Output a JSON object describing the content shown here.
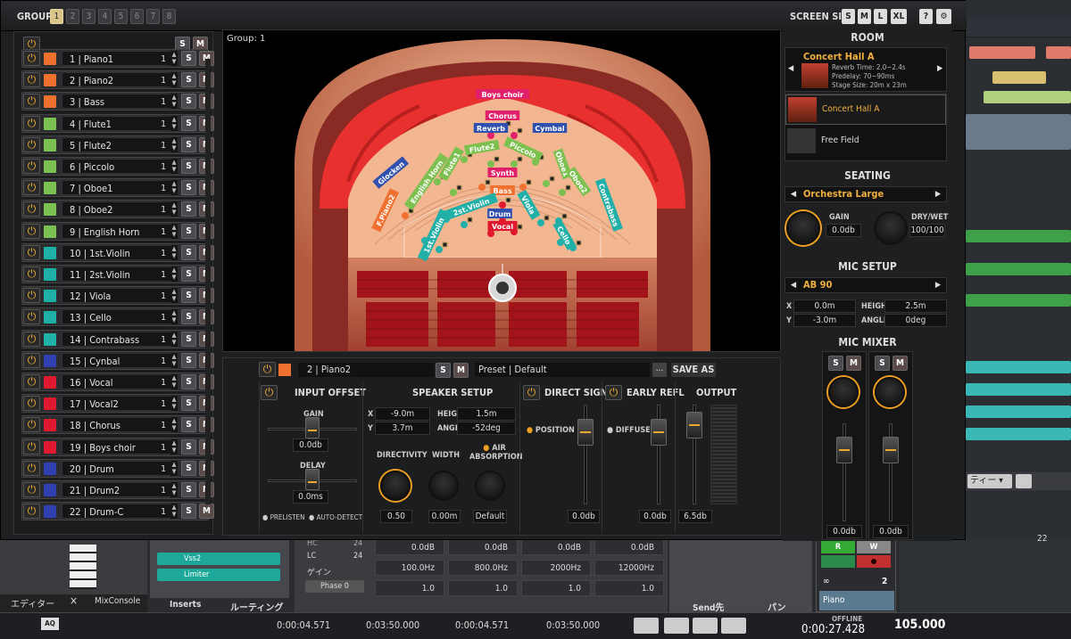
{
  "topbar": {
    "group_label": "GROUP",
    "groups": [
      "1",
      "2",
      "3",
      "4",
      "5",
      "6",
      "7",
      "8"
    ],
    "screen_size_label": "SCREEN SIZE",
    "sizes": [
      "S",
      "M",
      "L",
      "XL"
    ],
    "help": "?"
  },
  "tracklist": {
    "s": "S",
    "m": "M",
    "tracks": [
      {
        "num": "1",
        "name": "Piano1",
        "color": "#f07030"
      },
      {
        "num": "2",
        "name": "Piano2",
        "color": "#f07030"
      },
      {
        "num": "3",
        "name": "Bass",
        "color": "#f07030"
      },
      {
        "num": "4",
        "name": "Flute1",
        "color": "#7cc050"
      },
      {
        "num": "5",
        "name": "Flute2",
        "color": "#7cc050"
      },
      {
        "num": "6",
        "name": "Piccolo",
        "color": "#7cc050"
      },
      {
        "num": "7",
        "name": "Oboe1",
        "color": "#7cc050"
      },
      {
        "num": "8",
        "name": "Oboe2",
        "color": "#7cc050"
      },
      {
        "num": "9",
        "name": "English Horn",
        "color": "#7cc050"
      },
      {
        "num": "10",
        "name": "1st.Violin",
        "color": "#20b0a8"
      },
      {
        "num": "11",
        "name": "2st.Violin",
        "color": "#20b0a8"
      },
      {
        "num": "12",
        "name": "Viola",
        "color": "#20b0a8"
      },
      {
        "num": "13",
        "name": "Cello",
        "color": "#20b0a8"
      },
      {
        "num": "14",
        "name": "Contrabass",
        "color": "#20b0a8"
      },
      {
        "num": "15",
        "name": "Cynbal",
        "color": "#3040b0"
      },
      {
        "num": "16",
        "name": "Vocal",
        "color": "#e01830"
      },
      {
        "num": "17",
        "name": "Vocal2",
        "color": "#e01830"
      },
      {
        "num": "18",
        "name": "Chorus",
        "color": "#e01830"
      },
      {
        "num": "19",
        "name": "Boys choir",
        "color": "#e01830"
      },
      {
        "num": "20",
        "name": "Drum",
        "color": "#3040b0"
      },
      {
        "num": "21",
        "name": "Drum2",
        "color": "#3040b0"
      },
      {
        "num": "22",
        "name": "Drum-C",
        "color": "#3040b0"
      }
    ]
  },
  "stage": {
    "group_label": "Group: 1",
    "labels": [
      {
        "text": "Boys choir",
        "color": "#e0206a"
      },
      {
        "text": "Chorus",
        "color": "#e0206a"
      },
      {
        "text": "Reverb",
        "color": "#3050b0"
      },
      {
        "text": "Cymbal",
        "color": "#3050b0"
      },
      {
        "text": "Cymbal",
        "color": "#3050b0"
      },
      {
        "text": "Flute2",
        "color": "#7cc050"
      },
      {
        "text": "Piccolo",
        "color": "#7cc050"
      },
      {
        "text": "Flute1",
        "color": "#7cc050"
      },
      {
        "text": "Oboe1",
        "color": "#7cc050"
      },
      {
        "text": "Glocken",
        "color": "#3050b0"
      },
      {
        "text": "English Horn",
        "color": "#7cc050"
      },
      {
        "text": "Oboe2",
        "color": "#7cc050"
      },
      {
        "text": "Synth",
        "color": "#e0206a"
      },
      {
        "text": "Bass",
        "color": "#f07030"
      },
      {
        "text": "Contrabass",
        "color": "#20b0a8"
      },
      {
        "text": "2st.Violin",
        "color": "#20b0a8"
      },
      {
        "text": "Viola",
        "color": "#20b0a8"
      },
      {
        "text": "F.Piano2",
        "color": "#f07030"
      },
      {
        "text": "Drum",
        "color": "#3050b0"
      },
      {
        "text": "Vocal",
        "color": "#e01830"
      },
      {
        "text": "1st.Violin",
        "color": "#20b0a8"
      },
      {
        "text": "Cello",
        "color": "#20b0a8"
      }
    ]
  },
  "room": {
    "title": "ROOM",
    "selected": "Concert Hall A",
    "reverb": "Reverb Time: 2.0~2.4s",
    "predelay": "Predelay: 70~90ms",
    "stage_size": "Stage Size: 20m x 23m",
    "list": [
      "Concert Hall A",
      "Free Field"
    ]
  },
  "seating": {
    "title": "SEATING",
    "value": "Orchestra Large",
    "gain_label": "GAIN",
    "gain": "0.0db",
    "drywet_label": "DRY/WET",
    "drywet": "100/100"
  },
  "mic": {
    "title": "MIC SETUP",
    "value": "AB 90",
    "x_label": "X",
    "x": "0.0m",
    "height_label": "HEIGHT",
    "height": "2.5m",
    "y_label": "Y",
    "y": "-3.0m",
    "angle_label": "ANGLE",
    "angle": "0deg"
  },
  "micmixer": {
    "title": "MIC MIXER",
    "val1": "0.0db",
    "val2": "0.0db"
  },
  "editor": {
    "track": "2 | Piano2",
    "preset": "Preset | Default",
    "dots": "...",
    "saveas": "SAVE AS",
    "input_offset": "INPUT OFFSET",
    "gain_label": "GAIN",
    "gain": "0.0db",
    "delay_label": "DELAY",
    "delay": "0.0ms",
    "prelisten": "PRELISTEN",
    "autodetect": "AUTO-DETECT",
    "speaker_setup": "SPEAKER SETUP",
    "x_label": "X",
    "x": "-9.0m",
    "height_label": "HEIGHT",
    "height": "1.5m",
    "y_label": "Y",
    "y": "3.7m",
    "angle_label": "ANGLE",
    "angle": "-52deg",
    "directivity": "DIRECTIVITY",
    "width": "WIDTH",
    "air": "AIR ABSORPTION",
    "dir_val": "0.50",
    "width_val": "0.00m",
    "air_val": "Default",
    "direct_signal": "DIRECT SIGNAL",
    "position": "POSITION",
    "direct_val": "0.0db",
    "early_refl": "EARLY REFL",
    "diffuse": "DIFFUSE",
    "early_val": "0.0db",
    "output": "OUTPUT",
    "output_val": "6.5db"
  },
  "daw": {
    "editor_tab": "エディター",
    "mixconsole_tab": "MixConsole",
    "close": "×",
    "inserts": "Inserts",
    "routing": "ルーティング",
    "send": "Send先",
    "pan": "パン",
    "plugin1": "Vss2",
    "plugin2": "Limiter",
    "hc": "HC",
    "hc_val": "24",
    "lc": "LC",
    "lc_val": "24",
    "gain": "ゲイン",
    "phase": "Phase 0",
    "eq_gain": [
      "0.0dB",
      "0.0dB",
      "0.0dB",
      "0.0dB"
    ],
    "eq_freq": [
      "100.0Hz",
      "800.0Hz",
      "2000Hz",
      "12000Hz"
    ],
    "eq_q": [
      "1.0",
      "1.0",
      "1.0",
      "1.0"
    ],
    "track_name": "Piano",
    "track_num": "2",
    "r": "R",
    "w": "W",
    "offline": "OFFLINE",
    "time_main": "0:00:27.428",
    "tempo": "105.000",
    "t1": "0:00:04.571",
    "t2": "0:03:50.000",
    "t3": "0:00:04.571",
    "t4": "0:03:50.000",
    "aq": "AQ",
    "dropdown": "ティー",
    "ruler_mark": "22"
  }
}
